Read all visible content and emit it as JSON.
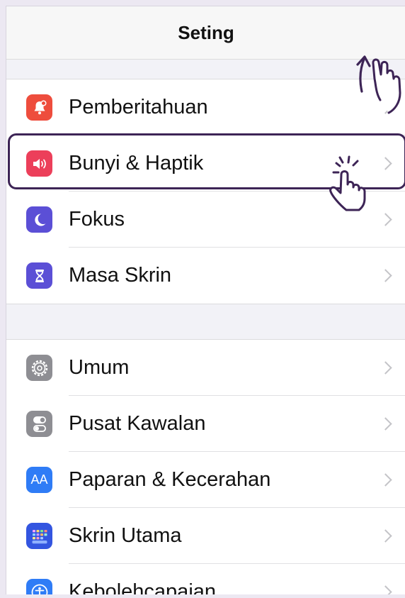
{
  "nav": {
    "title": "Seting"
  },
  "groups": [
    {
      "items": [
        {
          "label": "Pemberitahuan",
          "icon": "bell-badge-icon",
          "color": "#ee4d3d"
        },
        {
          "label": "Bunyi & Haptik",
          "icon": "speaker-icon",
          "color": "#ec3f5a"
        },
        {
          "label": "Fokus",
          "icon": "moon-icon",
          "color": "#5b4fd6"
        },
        {
          "label": "Masa Skrin",
          "icon": "hourglass-icon",
          "color": "#5b4fd6"
        }
      ]
    },
    {
      "items": [
        {
          "label": "Umum",
          "icon": "gear-icon",
          "color": "#8e8e93"
        },
        {
          "label": "Pusat Kawalan",
          "icon": "switches-icon",
          "color": "#8e8e93"
        },
        {
          "label": "Paparan & Kecerahan",
          "icon": "text-size-icon",
          "color": "#2f7cf6",
          "icon_text": "AA"
        },
        {
          "label": "Skrin Utama",
          "icon": "home-grid-icon",
          "color": "#3355e0"
        },
        {
          "label": "Kebolehcapaian",
          "icon": "accessibility-icon",
          "color": "#2f7cf6"
        }
      ]
    }
  ],
  "annotations": {
    "highlighted_item": "Bunyi & Haptik",
    "accent_color": "#3d2456",
    "gestures": [
      "swipe-up-hand-icon",
      "tap-hand-icon"
    ]
  }
}
